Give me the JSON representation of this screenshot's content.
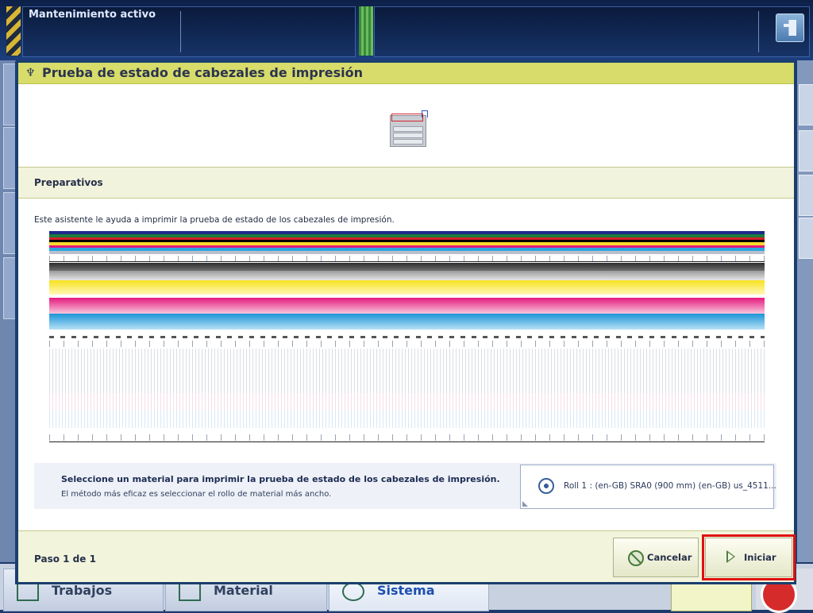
{
  "status_bar": {
    "maintenance_text": "Mantenimiento activo"
  },
  "bottom_tabs": [
    {
      "label": "Trabajos",
      "active": false
    },
    {
      "label": "Material",
      "active": false
    },
    {
      "label": "Sistema",
      "active": true
    }
  ],
  "dialog": {
    "title": "Prueba de estado de cabezales de impresión",
    "section_heading": "Preparativos",
    "intro_text": "Este asistente le ayuda a imprimir la prueba de estado de los cabezales de impresión.",
    "test_chart_colors": [
      "#1e2a8a",
      "#1b7d3c",
      "#d4202a",
      "#000000",
      "#f7d92c",
      "#e4197e",
      "#2aa6e0"
    ],
    "material": {
      "title": "Seleccione un material para imprimir la prueba de estado de los cabezales de impresión.",
      "subtitle": "El método más eficaz es seleccionar el rollo de material más ancho.",
      "selected_value": "Roll 1 : (en-GB) SRA0 (900 mm) (en-GB) us_4511..."
    },
    "footer": {
      "step_text": "Paso 1 de 1",
      "cancel_label": "Cancelar",
      "start_label": "Iniciar"
    }
  }
}
